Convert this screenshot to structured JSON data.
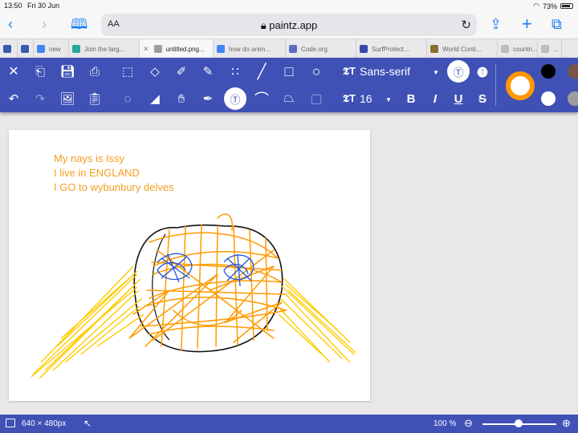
{
  "status_bar": {
    "time": "13:50",
    "date": "Fri 30 Jun",
    "battery": "73%"
  },
  "browser": {
    "text_size_label": "AA",
    "url": "paintz.app",
    "tabs": [
      {
        "label": "",
        "color": "#3a5bb0"
      },
      {
        "label": "",
        "color": "#3a5bb0"
      },
      {
        "label": "new",
        "color": "#4285f4"
      },
      {
        "label": "Join the larg...",
        "color": "#26a69a"
      },
      {
        "label": "untitled.png...",
        "color": "#9e9e9e",
        "active": true
      },
      {
        "label": "how do anim...",
        "color": "#4285f4"
      },
      {
        "label": "Code.org",
        "color": "#5c6bc0"
      },
      {
        "label": "SurfProtect...",
        "color": "#3949ab"
      },
      {
        "label": "World Conti...",
        "color": "#8d6e2f"
      },
      {
        "label": "countri...",
        "color": "#bdbdbd"
      },
      {
        "label": "...",
        "color": "#bdbdbd"
      }
    ]
  },
  "toolbar": {
    "font_family": "Sans-serif",
    "font_size": "16",
    "fill_color": "#ff9800",
    "palette": [
      "#000000",
      "#795548",
      "#ffffff",
      "#9e9e9e"
    ]
  },
  "canvas": {
    "lines": [
      "My nays is Issy",
      "I live in ENGLAND",
      "I GO to wybunbury delves"
    ],
    "text_color": "#f4a020"
  },
  "bottom_bar": {
    "dimensions": "640 × 480px",
    "zoom": "100 %"
  }
}
